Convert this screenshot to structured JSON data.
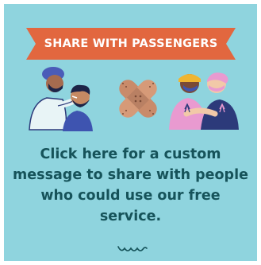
{
  "banner": {
    "text": "SHARE WITH PASSENGERS",
    "color": "#e2673f"
  },
  "message": {
    "text": "Click here for a custom message to share with people who could use our free service.",
    "color": "#16535a"
  },
  "colors": {
    "background": "#8fd4de",
    "accent_orange": "#e2673f",
    "navy": "#2c3a7a",
    "bandage": "#c98b6a"
  },
  "icons": [
    "healthcare-worker-testing-patient-icon",
    "crossed-bandages-icon",
    "two-people-hugging-icon",
    "squiggle-decoration-icon"
  ]
}
